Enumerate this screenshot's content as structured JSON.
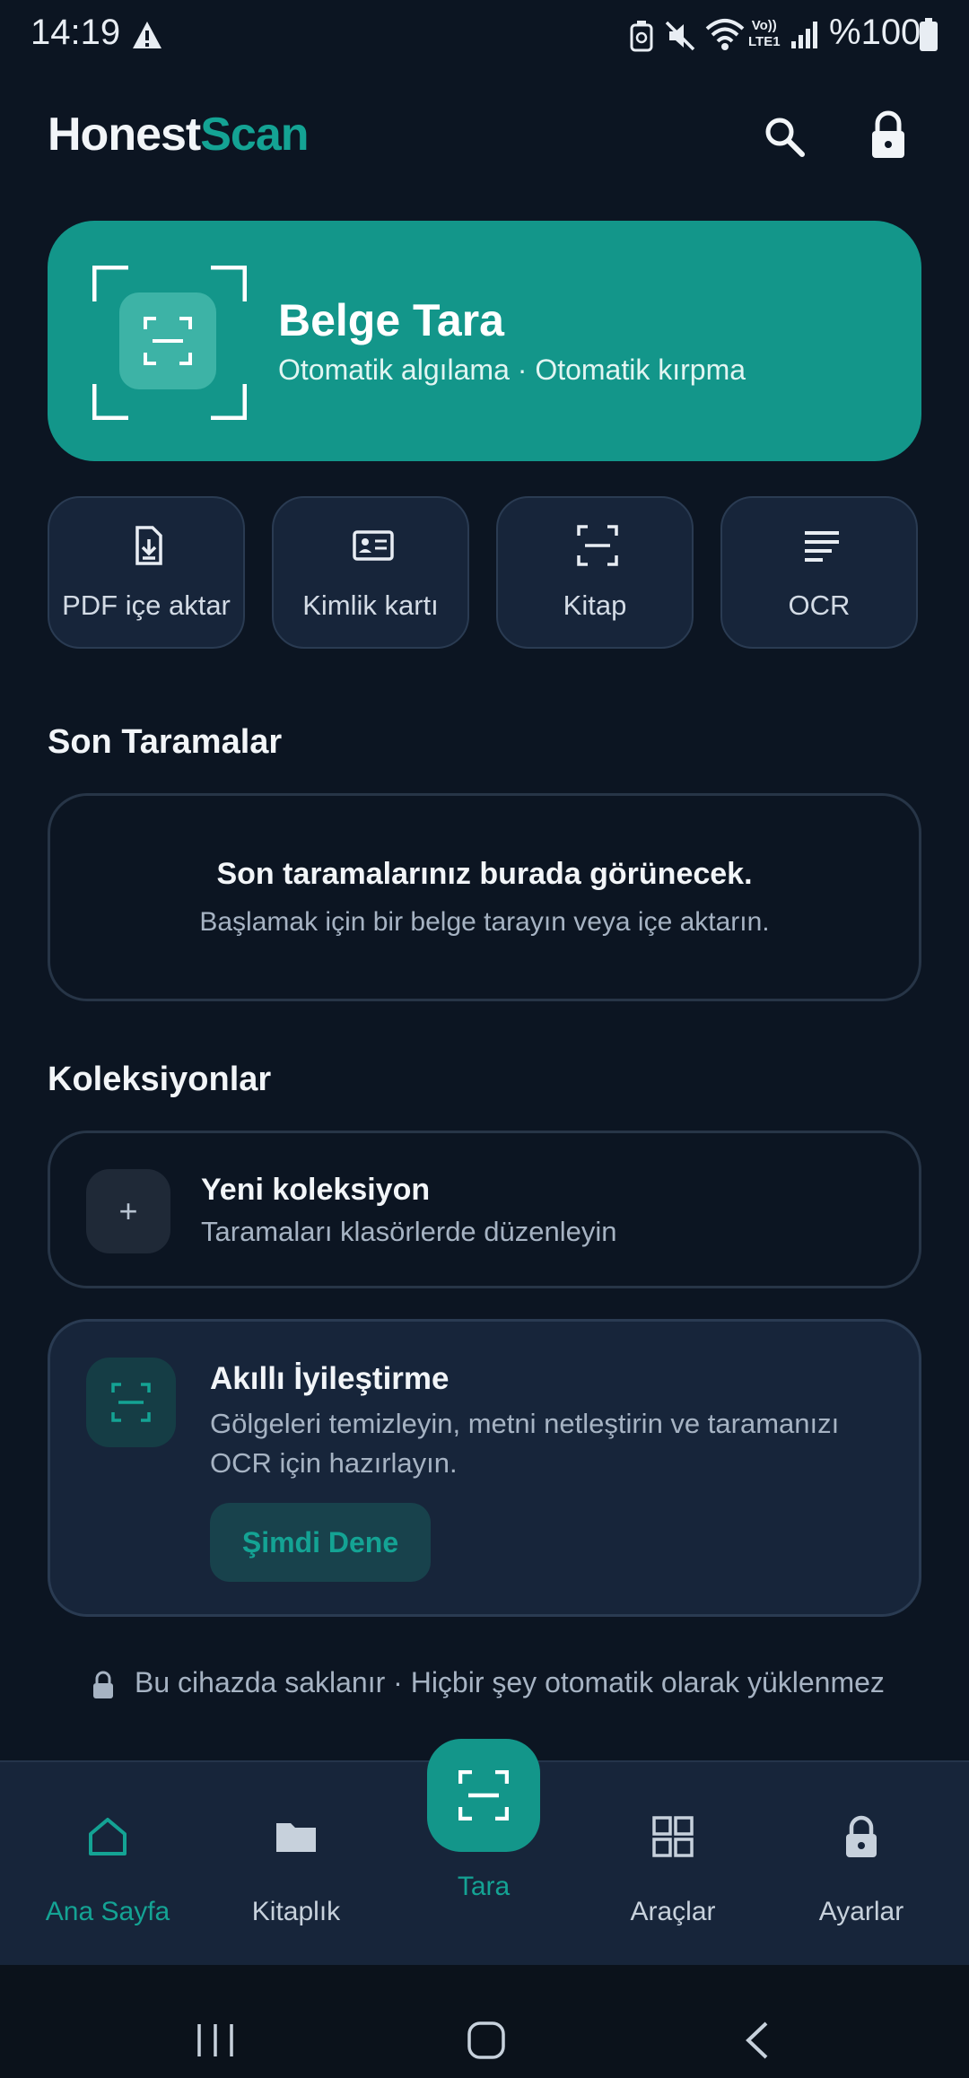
{
  "status_bar": {
    "time": "14:19",
    "battery": "%100",
    "icons": [
      "warning-icon",
      "alarm-icon",
      "mute-icon",
      "wifi-icon",
      "volte-icon",
      "signal-icon",
      "battery-icon"
    ],
    "volte_text_1": "Vo))",
    "volte_text_2": "LTE1"
  },
  "header": {
    "logo_part1": "Honest",
    "logo_part2": "Scan",
    "icons": [
      "search-icon",
      "lock-icon"
    ]
  },
  "hero": {
    "title": "Belge Tara",
    "subtitle": "Otomatik algılama · Otomatik kırpma"
  },
  "quick_actions": [
    {
      "label": "PDF içe aktar",
      "icon": "pdf-import-icon"
    },
    {
      "label": "Kimlik kartı",
      "icon": "id-card-icon"
    },
    {
      "label": "Kitap",
      "icon": "book-scan-icon"
    },
    {
      "label": "OCR",
      "icon": "ocr-text-icon"
    }
  ],
  "recent": {
    "title": "Son Taramalar",
    "empty_title": "Son taramalarınız burada görünecek.",
    "empty_sub": "Başlamak için bir belge tarayın veya içe aktarın."
  },
  "collections": {
    "title": "Koleksiyonlar",
    "plus": "+",
    "new_title": "Yeni koleksiyon",
    "new_sub": "Taramaları klasörlerde düzenleyin"
  },
  "smart": {
    "title": "Akıllı İyileştirme",
    "desc": "Gölgeleri temizleyin, metni netleştirin ve taramanızı OCR için hazırlayın.",
    "button": "Şimdi Dene"
  },
  "privacy_note": "Bu cihazda saklanır · Hiçbir şey otomatik olarak yüklenmez",
  "bottom_nav": [
    {
      "label": "Ana Sayfa",
      "icon": "home-icon",
      "active": true
    },
    {
      "label": "Kitaplık",
      "icon": "folder-icon",
      "active": false
    },
    {
      "label": "Tara",
      "icon": "scan-icon",
      "active": true
    },
    {
      "label": "Araçlar",
      "icon": "grid-icon",
      "active": false
    },
    {
      "label": "Ayarlar",
      "icon": "lock-icon",
      "active": false
    }
  ],
  "colors": {
    "background": "#0c1522",
    "accent": "#14a394",
    "card": "#17253a"
  }
}
